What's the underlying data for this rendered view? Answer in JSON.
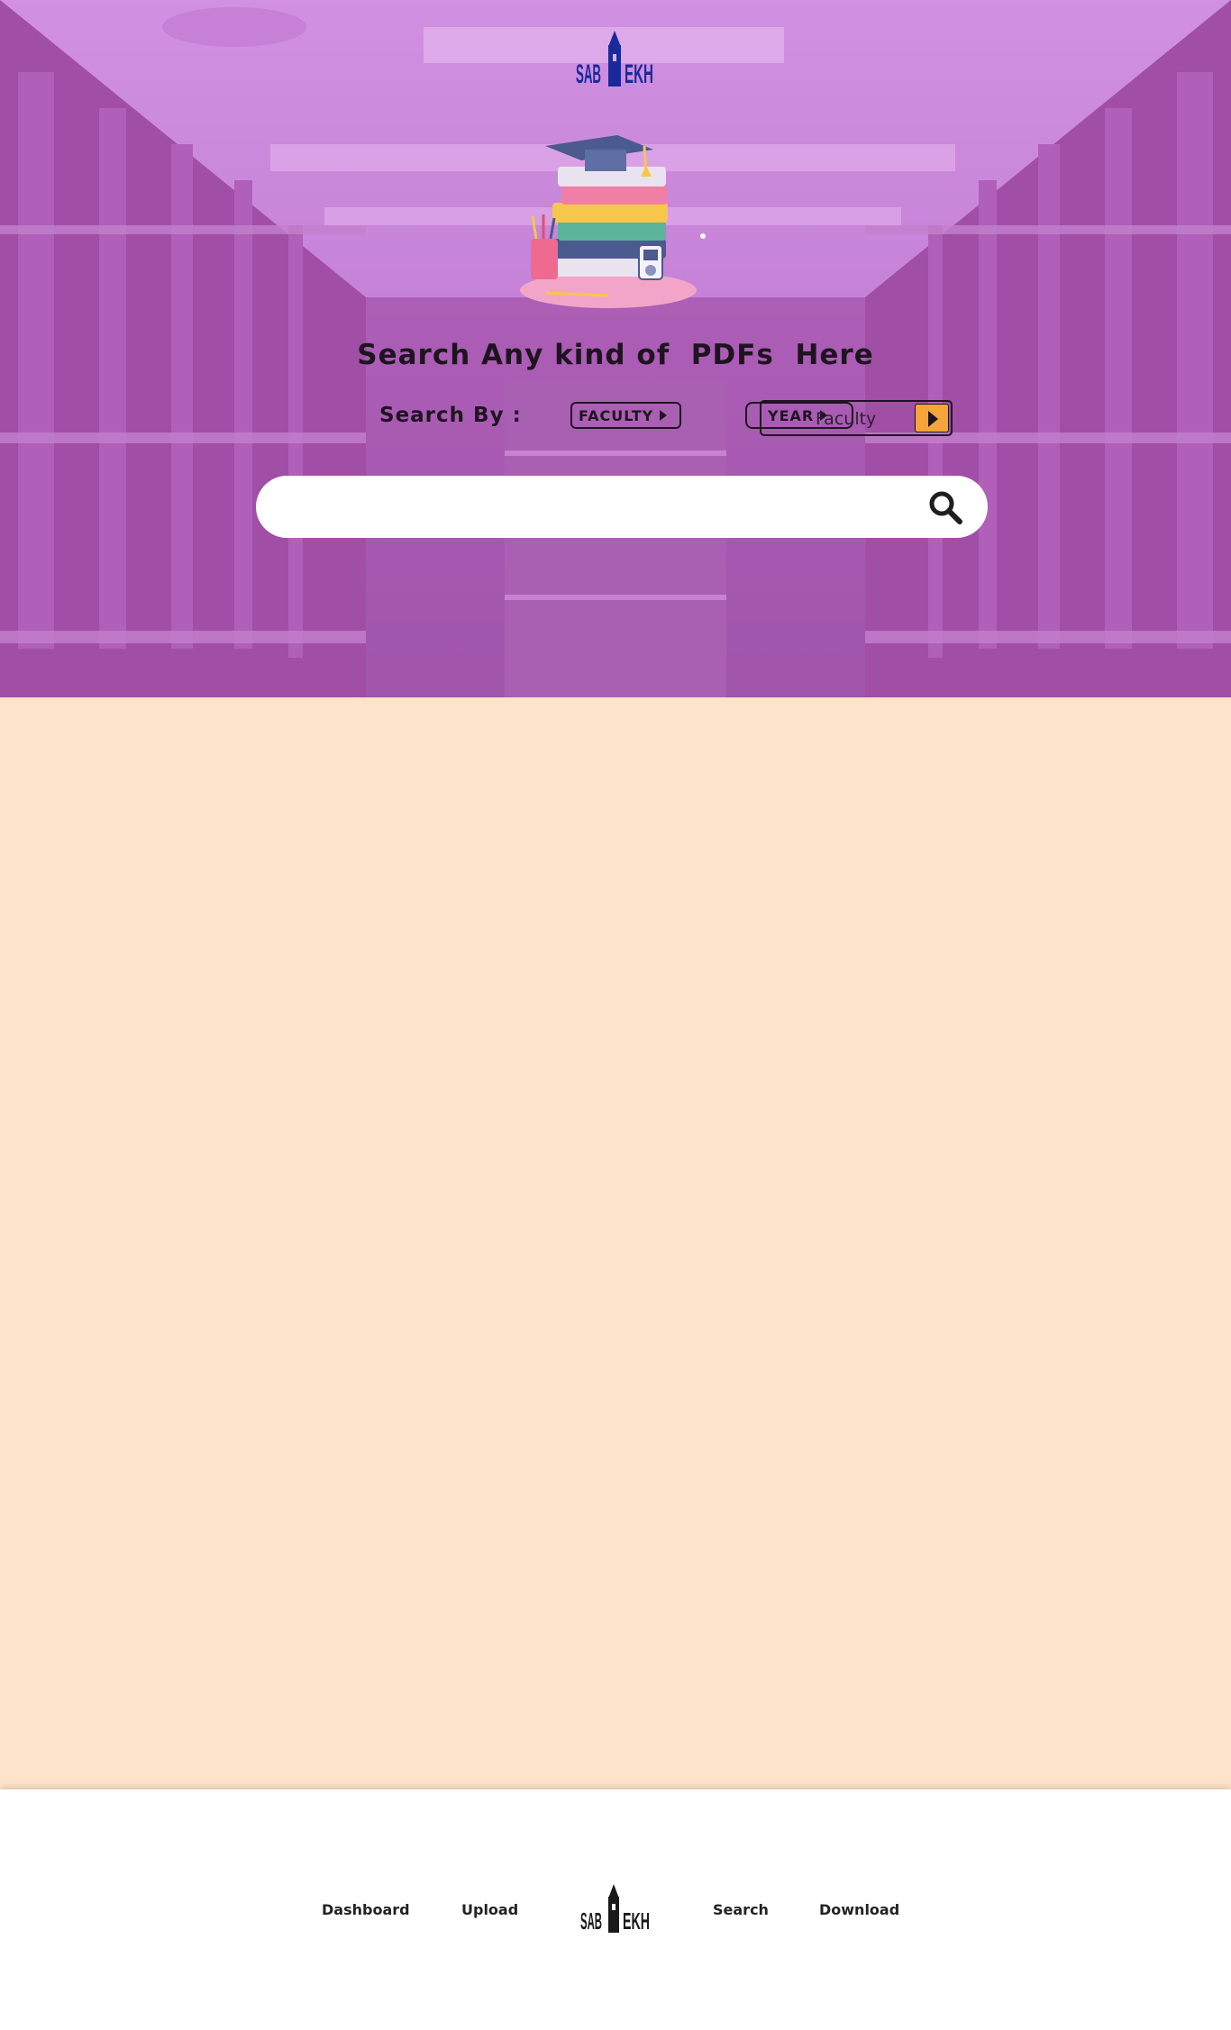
{
  "brand": {
    "logo_text": "SABEKH",
    "logo_color": "#1a2a9a",
    "footer_logo_color": "#1a1a1a"
  },
  "hero": {
    "headline": "Search Any kind of  PDFs  Here",
    "search_by_label": "Search By :",
    "filters": {
      "faculty_label": "FACULTY",
      "year_label": "YEAR",
      "faculty_select_value": "Faculty"
    },
    "search": {
      "placeholder": "",
      "value": ""
    },
    "overlay_color": "#c46ed6"
  },
  "page": {
    "background": "#fde3c9"
  },
  "footer": {
    "links": {
      "dashboard": "Dashboard",
      "upload": "Upload",
      "search": "Search",
      "download": "Download"
    }
  },
  "accent": "#f5a53a"
}
